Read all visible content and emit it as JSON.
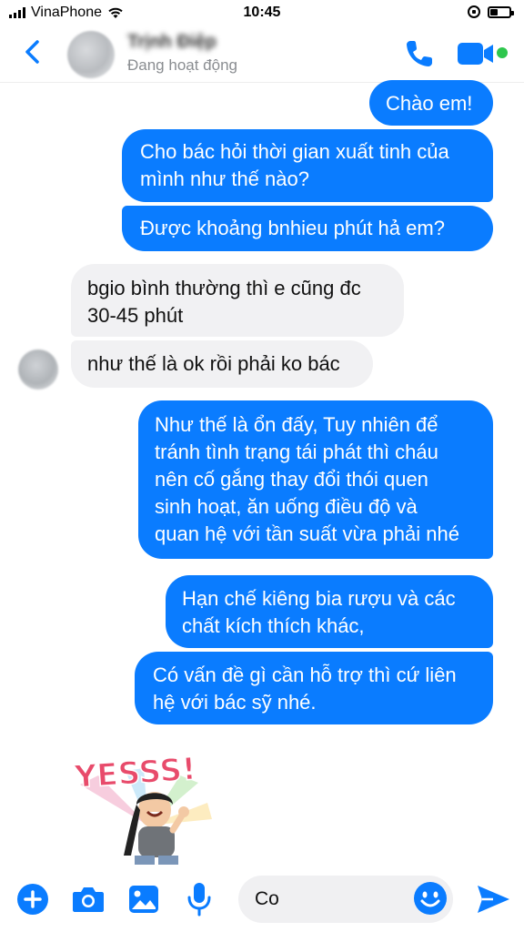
{
  "status_bar": {
    "carrier": "VinaPhone",
    "time": "10:45"
  },
  "header": {
    "contact_name": "Trịnh Điệp",
    "contact_status": "Đang hoạt động"
  },
  "messages": [
    {
      "direction": "out",
      "text": "Chào em!"
    },
    {
      "direction": "out",
      "text": "Cho bác hỏi thời gian xuất tinh của\nmình như thế nào?"
    },
    {
      "direction": "out",
      "text": "Được khoảng bnhieu phút hả em?"
    },
    {
      "direction": "in",
      "text": "bgio bình thường thì e cũng đc\n30-45 phút"
    },
    {
      "direction": "in",
      "text": "như thế là ok rồi phải ko bác"
    },
    {
      "direction": "out",
      "text": "Như thế là ổn đấy, Tuy nhiên để\ntránh tình trạng tái phát thì cháu\nnên cố gắng thay đổi thói quen\nsinh hoạt, ăn uống điều độ và\nquan hệ với tần suất vừa phải nhé"
    },
    {
      "direction": "out",
      "text": "Hạn chế kiêng bia rượu và các\nchất kích thích khác,"
    },
    {
      "direction": "out",
      "text": "Có vấn đề gì cần hỗ trợ thì cứ liên\nhệ với bác sỹ nhé."
    }
  ],
  "sticker": {
    "text": "YESSS!"
  },
  "composer": {
    "input_value": "Co"
  },
  "colors": {
    "accent": "#0a7cff",
    "incoming_bubble": "#f1f1f3",
    "online": "#2ec64d"
  },
  "icons": [
    "back-chevron-icon",
    "phone-icon",
    "video-camera-icon",
    "plus-icon",
    "camera-icon",
    "image-icon",
    "microphone-icon",
    "emoji-icon",
    "send-icon"
  ]
}
